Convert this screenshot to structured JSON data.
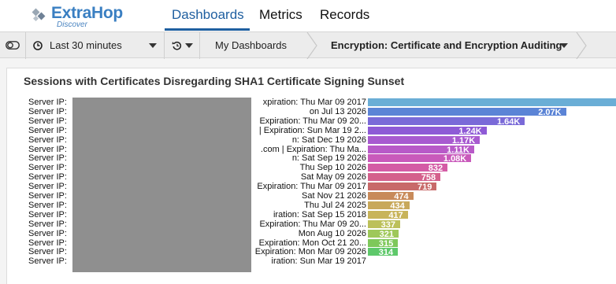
{
  "app": {
    "logo_text": "ExtraHop",
    "logo_sub": "Discover",
    "nav": [
      "Dashboards",
      "Metrics",
      "Records"
    ]
  },
  "toolbar": {
    "time_range": "Last 30 minutes",
    "breadcrumb_1": "My Dashboards",
    "breadcrumb_2": "Encryption: Certificate and Encryption Auditing"
  },
  "panel": {
    "title": "Sessions with Certificates Disregarding SHA1 Certificate Signing Sunset"
  },
  "chart_data": {
    "type": "bar",
    "orientation": "horizontal",
    "categories": [
      {
        "prefix": "Server IP:",
        "tail": "xpiration: Thu Mar 09 2017"
      },
      {
        "prefix": "Server IP:",
        "tail": "on Jul 13 2026"
      },
      {
        "prefix": "Server IP:",
        "tail": "Expiration: Thu Mar 09 20..."
      },
      {
        "prefix": "Server IP:",
        "tail": "| Expiration: Sun Mar 19 2..."
      },
      {
        "prefix": "Server IP:",
        "tail": "n: Sat Dec 19 2026"
      },
      {
        "prefix": "Server IP:",
        "tail": ".com | Expiration: Thu Ma..."
      },
      {
        "prefix": "Server IP:",
        "tail": "n: Sat Sep 19 2026"
      },
      {
        "prefix": "Server IP:",
        "tail": "Thu Sep 10 2026"
      },
      {
        "prefix": "Server IP:",
        "tail": "Sat May 09 2026"
      },
      {
        "prefix": "Server IP:",
        "tail": "Expiration: Thu Mar 09 2017"
      },
      {
        "prefix": "Server IP:",
        "tail": "Sat Nov 21 2026"
      },
      {
        "prefix": "Server IP:",
        "tail": "Thu Jul 24 2025"
      },
      {
        "prefix": "Server IP:",
        "tail": "iration: Sat Sep 15 2018"
      },
      {
        "prefix": "Server IP:",
        "tail": "Expiration: Thu Mar 09 20..."
      },
      {
        "prefix": "Server IP:",
        "tail": "Mon Aug 10 2026"
      },
      {
        "prefix": "Server IP:",
        "tail": "Expiration: Mon Oct 21 20..."
      },
      {
        "prefix": "Server IP:",
        "tail": "Expiration: Mon Mar 09 2026"
      },
      {
        "prefix": "Server IP:",
        "tail": "iration: Sun Mar 19 2017"
      }
    ],
    "values": [
      2600,
      2070,
      1640,
      1240,
      1170,
      1110,
      1080,
      832,
      758,
      719,
      474,
      434,
      417,
      337,
      321,
      315,
      314
    ],
    "value_labels": [
      "",
      "2.07K",
      "1.64K",
      "1.24K",
      "1.17K",
      "1.11K",
      "1.08K",
      "832",
      "758",
      "719",
      "474",
      "434",
      "417",
      "337",
      "321",
      "315",
      "314"
    ],
    "colors": [
      "#6aaed6",
      "#5b84d6",
      "#7a6ad8",
      "#8e5ad6",
      "#a85ad0",
      "#b85ac8",
      "#c95abb",
      "#d45ca5",
      "#d4608c",
      "#c86a6a",
      "#c88a5a",
      "#c8a85a",
      "#c8b45a",
      "#bcc05a",
      "#9ec85a",
      "#7ec85a",
      "#5ec86a"
    ],
    "grid": false,
    "legend": "none"
  }
}
